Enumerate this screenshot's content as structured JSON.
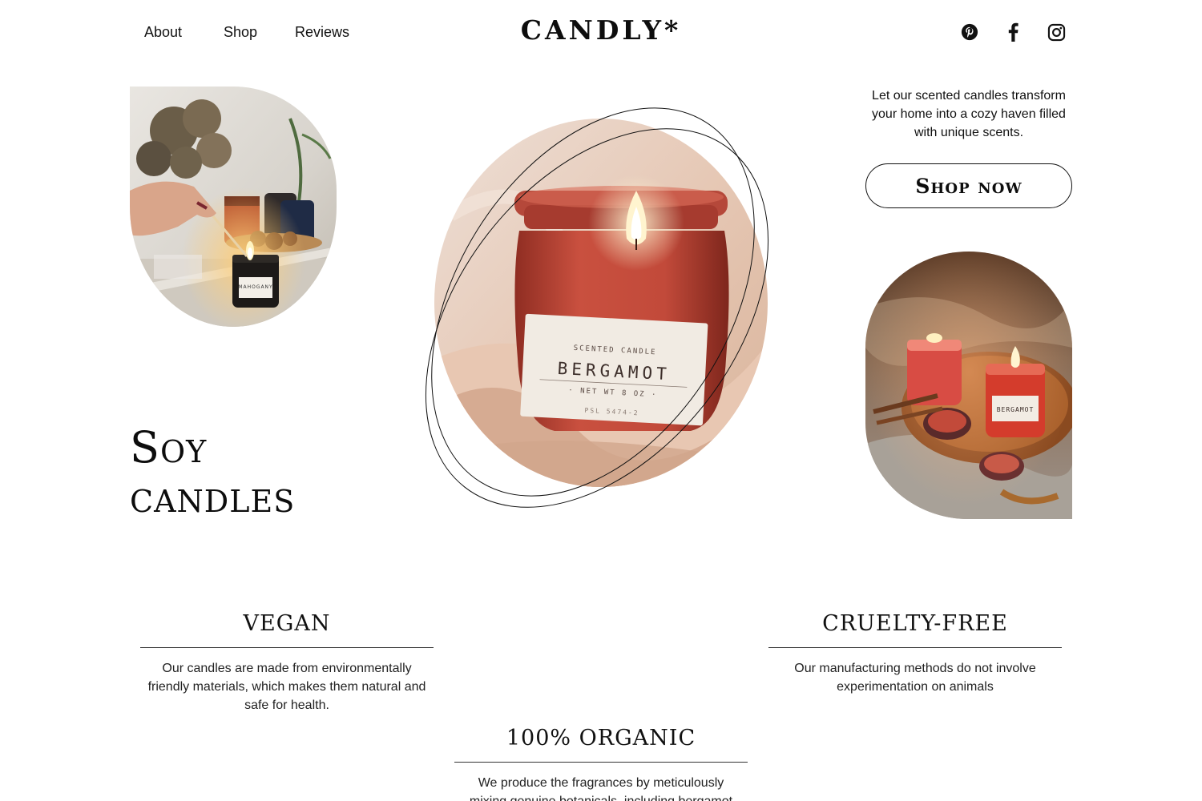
{
  "nav": {
    "links": [
      "About",
      "Shop",
      "Reviews"
    ],
    "logo": "CANDLY*"
  },
  "social": {
    "icons": [
      "pinterest-icon",
      "facebook-icon",
      "instagram-icon"
    ]
  },
  "hero": {
    "headline_line1": "Soy",
    "headline_line2": "candles",
    "tagline": "Let our scented candles transform your home into a cozy haven filled with unique scents.",
    "cta": "Shop now"
  },
  "images": {
    "left_label": "MAHOGANY",
    "center_label_top": "SCENTED CANDLE",
    "center_label_main": "BERGAMOT",
    "center_label_sub": "· NET WT 8 OZ ·",
    "center_label_code": "PSL 5474-2",
    "right_label": "BERGAMOT"
  },
  "features": [
    {
      "title": "VEGAN",
      "text": "Our candles are made from environmentally friendly materials, which makes them natural and safe for health."
    },
    {
      "title": "CRUELTY-FREE",
      "text": "Our manufacturing methods do not involve experimentation on animals"
    },
    {
      "title": "100% ORGANIC",
      "text": "We produce the fragrances by meticulously mixing genuine botanicals, including bergamot"
    }
  ],
  "colors": {
    "text": "#111111",
    "background": "#ffffff",
    "candle_red": "#c0473a",
    "warm_beige": "#e9cfc0"
  }
}
